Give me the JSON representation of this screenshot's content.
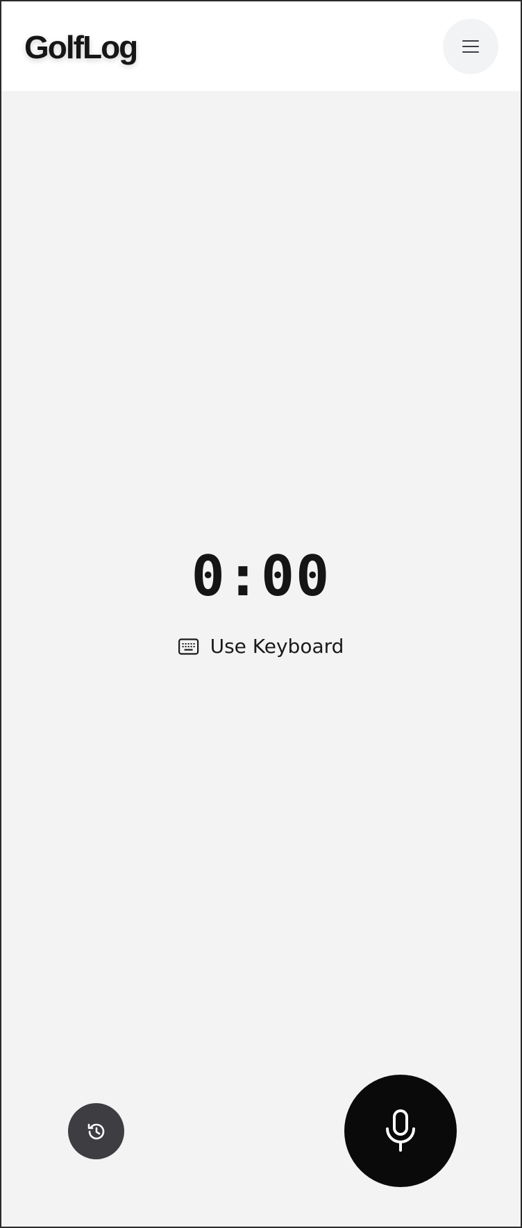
{
  "header": {
    "brand": "GolfLog",
    "menu_icon": "hamburger-menu-icon"
  },
  "main": {
    "timer": "0:00",
    "keyboard_toggle": {
      "label": "Use Keyboard",
      "icon": "keyboard-icon"
    }
  },
  "controls": {
    "history_icon": "history-icon",
    "mic_icon": "microphone-icon"
  },
  "colors": {
    "header_bg": "#ffffff",
    "page_bg": "#f3f3f3",
    "menu_button_bg": "#f2f3f5",
    "history_button_bg": "#3d3d42",
    "mic_button_bg": "#0a0a0b",
    "text": "#111111"
  }
}
